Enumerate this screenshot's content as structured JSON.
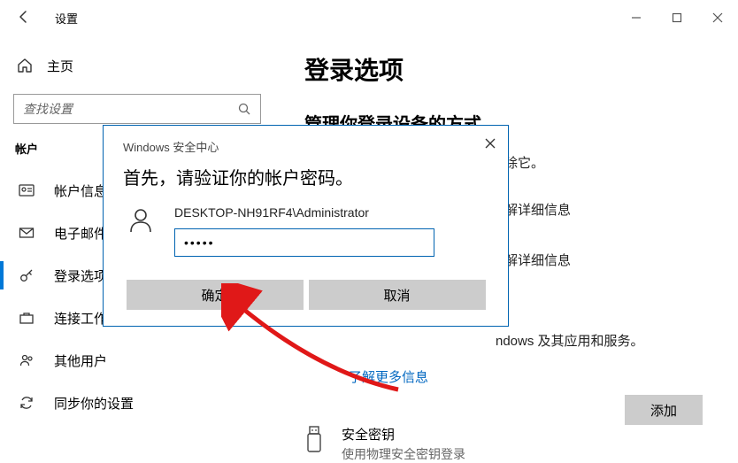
{
  "window": {
    "title": "设置",
    "minimize": "—",
    "maximize": "▢",
    "close": "×"
  },
  "sidebar": {
    "home": "主页",
    "search_placeholder": "查找设置",
    "group": "帐户",
    "items": [
      {
        "icon": "user-card",
        "label": "帐户信息"
      },
      {
        "icon": "mail",
        "label": "电子邮件和"
      },
      {
        "icon": "key",
        "label": "登录选项",
        "active": true
      },
      {
        "icon": "briefcase",
        "label": "连接工作或"
      },
      {
        "icon": "people",
        "label": "其他用户"
      },
      {
        "icon": "sync",
        "label": "同步你的设置"
      }
    ]
  },
  "content": {
    "title": "登录选项",
    "subtitle": "管理你登录设备的方式",
    "row1_tail": "除它。",
    "row2_tail": "解详细信息",
    "row3_tail": "解详细信息",
    "row4_tail": "ndows 及其应用和服务。",
    "more_link": "了解更多信息",
    "add_button": "添加",
    "seckey_title": "安全密钥",
    "seckey_sub": "使用物理安全密钥登录"
  },
  "modal": {
    "app_title": "Windows 安全中心",
    "heading": "首先，请验证你的帐户密码。",
    "username": "DESKTOP-NH91RF4\\Administrator",
    "password_masked": "•••••",
    "ok": "确定",
    "cancel": "取消"
  }
}
